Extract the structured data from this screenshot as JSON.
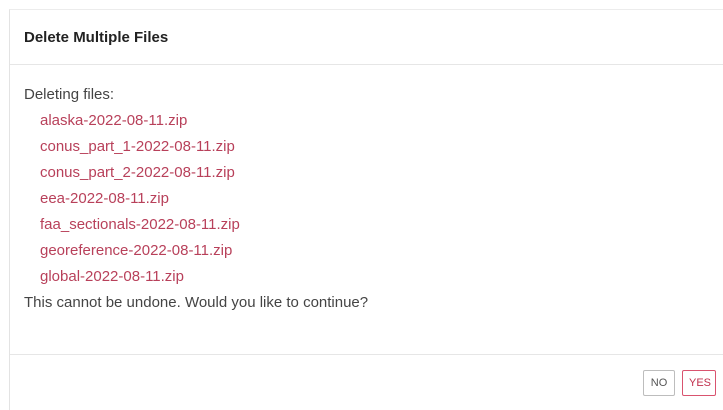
{
  "dialog": {
    "title": "Delete Multiple Files",
    "intro": "Deleting files:",
    "files": [
      "alaska-2022-08-11.zip",
      "conus_part_1-2022-08-11.zip",
      "conus_part_2-2022-08-11.zip",
      "eea-2022-08-11.zip",
      "faa_sectionals-2022-08-11.zip",
      "georeference-2022-08-11.zip",
      "global-2022-08-11.zip"
    ],
    "warning": "This cannot be undone. Would you like to continue?",
    "buttons": {
      "no_label": "NO",
      "yes_label": "YES"
    }
  },
  "colors": {
    "file_text": "#b8405a",
    "yes_border": "#d9536f",
    "no_border": "#bdbdbd"
  }
}
